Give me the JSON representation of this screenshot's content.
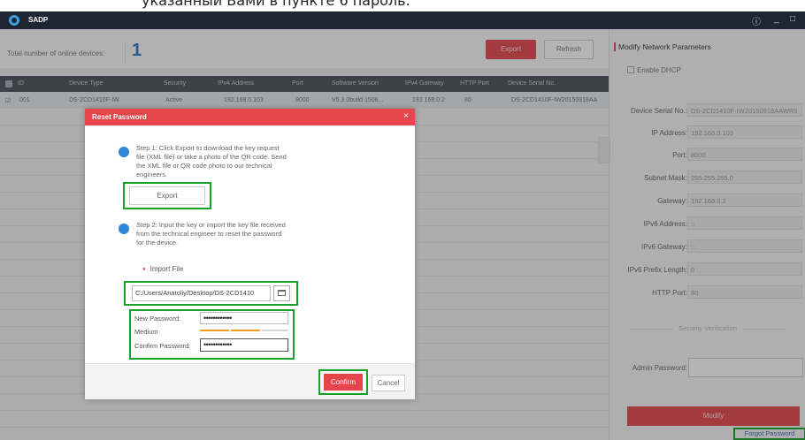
{
  "caption": "указанный Вами в пункте 6 пароль.",
  "app": {
    "title": "SADP",
    "controls": {
      "info": "ⓘ",
      "minimize": "_",
      "maximize": "□"
    }
  },
  "summary": {
    "label": "Total number of online devices:",
    "count": "1",
    "export_label": "Export",
    "refresh_label": "Refresh"
  },
  "table": {
    "columns": [
      "ID",
      "Device Type",
      "Security",
      "IPv4 Address",
      "Port",
      "Software Version",
      "IPv4 Gateway",
      "HTTP Port",
      "Device Serial No."
    ],
    "row": {
      "id": "001",
      "device_type": "DS-2CD1410F-IW",
      "security": "Active",
      "ipv4": "192.168.0.103",
      "port": "8000",
      "software": "V5.3.0build 1508...",
      "gateway": "192.168.0.2",
      "http_port": "80",
      "serial": "DS-2CD1410F-IW20150918AA"
    }
  },
  "panel": {
    "title": "Modify Network Parameters",
    "dhcp_label": "Enable DHCP",
    "fields": [
      {
        "label": "Device Serial No.:",
        "value": "DS-2CD1410F-IW20150918AAWR5"
      },
      {
        "label": "IP Address:",
        "value": "192.168.0.103"
      },
      {
        "label": "Port:",
        "value": "8000"
      },
      {
        "label": "Subnet Mask:",
        "value": "255.255.255.0"
      },
      {
        "label": "Gateway:",
        "value": "192.168.0.2"
      },
      {
        "label": "IPv6 Address:",
        "value": "::"
      },
      {
        "label": "IPv6 Gateway:",
        "value": "::"
      },
      {
        "label": "IPv6 Prefix Length:",
        "value": "0"
      },
      {
        "label": "HTTP Port:",
        "value": "80"
      }
    ],
    "security_verification": "Security Verification",
    "admin_password_label": "Admin Password:",
    "modify_label": "Modify",
    "forgot_label": "Forgot Password"
  },
  "dialog": {
    "title": "Reset Password",
    "close": "×",
    "step1": {
      "lines": [
        "Step 1: Click Export to download the key request",
        "file (XML file) or take a photo of the QR code. Send",
        "the XML file or QR code photo to our technical",
        "engineers."
      ],
      "export_label": "Export"
    },
    "step2": {
      "lines": [
        "Step 2: Input the key or import the key file received",
        "from the technical engineer to reset the password",
        "for the device."
      ]
    },
    "import_label": "Import File",
    "file_path": "C:/Users/Anatoliy/Desktop/DS-2CD1410",
    "new_password_label": "New Password:",
    "new_password_value": "••••••••••••",
    "strength_label": "Medium",
    "confirm_password_label": "Confirm Password:",
    "confirm_password_value": "••••••••••••",
    "confirm_label": "Confirm",
    "cancel_label": "Cancel"
  },
  "colors": {
    "accent_red": "#e5454b",
    "highlight_green": "#17a02a",
    "step_blue": "#2f86d6",
    "strength_orange": "#f0a020"
  }
}
